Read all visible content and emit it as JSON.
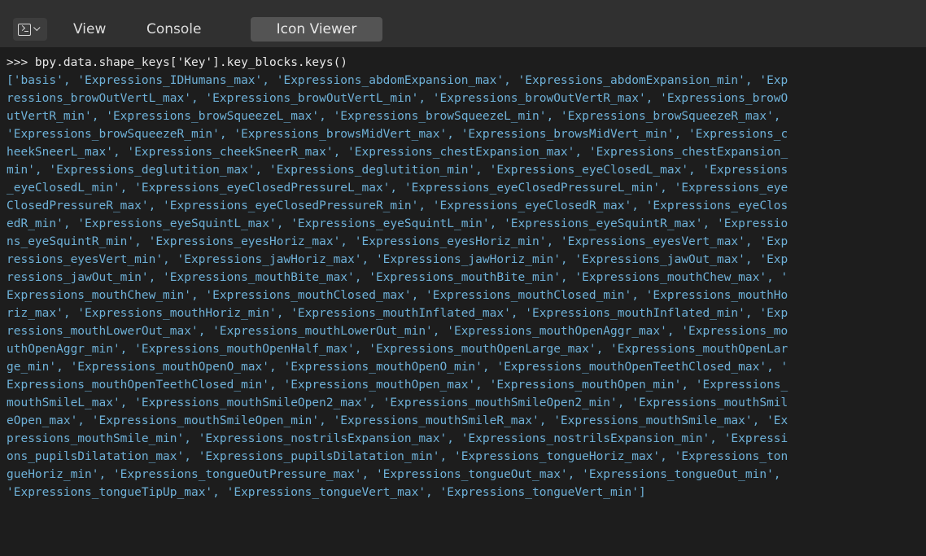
{
  "header": {
    "editor_type_icon": "console-icon",
    "menu_view": "View",
    "menu_console": "Console",
    "tab_icon_viewer": "Icon Viewer"
  },
  "console": {
    "command": ">>> bpy.data.shape_keys['Key'].key_blocks.keys()",
    "output_lines": [
      "['basis', 'Expressions_IDHumans_max', 'Expressions_abdomExpansion_max', 'Expressions_abdomExpansion_min', 'Exp",
      "ressions_browOutVertL_max', 'Expressions_browOutVertL_min', 'Expressions_browOutVertR_max', 'Expressions_browO",
      "utVertR_min', 'Expressions_browSqueezeL_max', 'Expressions_browSqueezeL_min', 'Expressions_browSqueezeR_max', ",
      "'Expressions_browSqueezeR_min', 'Expressions_browsMidVert_max', 'Expressions_browsMidVert_min', 'Expressions_c",
      "heekSneerL_max', 'Expressions_cheekSneerR_max', 'Expressions_chestExpansion_max', 'Expressions_chestExpansion_",
      "min', 'Expressions_deglutition_max', 'Expressions_deglutition_min', 'Expressions_eyeClosedL_max', 'Expressions",
      "_eyeClosedL_min', 'Expressions_eyeClosedPressureL_max', 'Expressions_eyeClosedPressureL_min', 'Expressions_eye",
      "ClosedPressureR_max', 'Expressions_eyeClosedPressureR_min', 'Expressions_eyeClosedR_max', 'Expressions_eyeClos",
      "edR_min', 'Expressions_eyeSquintL_max', 'Expressions_eyeSquintL_min', 'Expressions_eyeSquintR_max', 'Expressio",
      "ns_eyeSquintR_min', 'Expressions_eyesHoriz_max', 'Expressions_eyesHoriz_min', 'Expressions_eyesVert_max', 'Exp",
      "ressions_eyesVert_min', 'Expressions_jawHoriz_max', 'Expressions_jawHoriz_min', 'Expressions_jawOut_max', 'Exp",
      "ressions_jawOut_min', 'Expressions_mouthBite_max', 'Expressions_mouthBite_min', 'Expressions_mouthChew_max', '",
      "Expressions_mouthChew_min', 'Expressions_mouthClosed_max', 'Expressions_mouthClosed_min', 'Expressions_mouthHo",
      "riz_max', 'Expressions_mouthHoriz_min', 'Expressions_mouthInflated_max', 'Expressions_mouthInflated_min', 'Exp",
      "ressions_mouthLowerOut_max', 'Expressions_mouthLowerOut_min', 'Expressions_mouthOpenAggr_max', 'Expressions_mo",
      "uthOpenAggr_min', 'Expressions_mouthOpenHalf_max', 'Expressions_mouthOpenLarge_max', 'Expressions_mouthOpenLar",
      "ge_min', 'Expressions_mouthOpenO_max', 'Expressions_mouthOpenO_min', 'Expressions_mouthOpenTeethClosed_max', '",
      "Expressions_mouthOpenTeethClosed_min', 'Expressions_mouthOpen_max', 'Expressions_mouthOpen_min', 'Expressions_",
      "mouthSmileL_max', 'Expressions_mouthSmileOpen2_max', 'Expressions_mouthSmileOpen2_min', 'Expressions_mouthSmil",
      "eOpen_max', 'Expressions_mouthSmileOpen_min', 'Expressions_mouthSmileR_max', 'Expressions_mouthSmile_max', 'Ex",
      "pressions_mouthSmile_min', 'Expressions_nostrilsExpansion_max', 'Expressions_nostrilsExpansion_min', 'Expressi",
      "ons_pupilsDilatation_max', 'Expressions_pupilsDilatation_min', 'Expressions_tongueHoriz_max', 'Expressions_ton",
      "gueHoriz_min', 'Expressions_tongueOutPressure_max', 'Expressions_tongueOut_max', 'Expressions_tongueOut_min', ",
      "'Expressions_tongueTipUp_max', 'Expressions_tongueVert_max', 'Expressions_tongueVert_min']"
    ]
  }
}
